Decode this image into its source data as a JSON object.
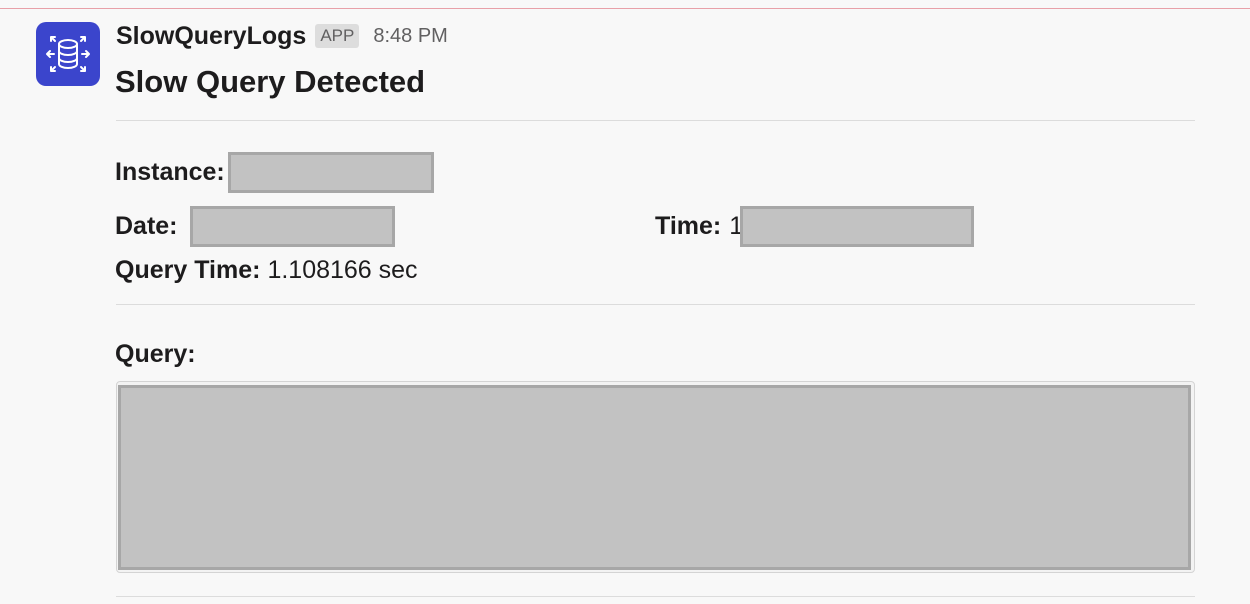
{
  "message": {
    "app_name": "SlowQueryLogs",
    "app_badge": "APP",
    "timestamp": "8:48 PM",
    "title": "Slow Query Detected",
    "avatar_icon": "database-icon",
    "avatar_color": "#3b45cc"
  },
  "fields": {
    "instance_label": "Instance:",
    "date_label": "Date:",
    "time_label": "Time:",
    "time_prefix_visible": "1",
    "query_time_label": "Query Time:",
    "query_time_value": "1.108166 sec",
    "query_label": "Query:"
  }
}
